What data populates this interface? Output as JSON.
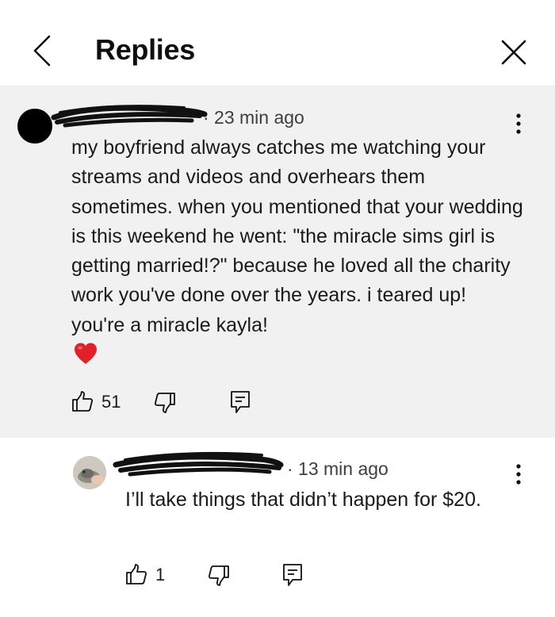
{
  "header": {
    "title": "Replies"
  },
  "parent_comment": {
    "time": "· 23 min ago",
    "text": "my boyfriend always catches me watching your streams and videos and overhears them sometimes. when you mentioned that your wedding is this weekend he went: \"the miracle sims girl is getting married!?\" because he loved all the charity work you've done over the years. i teared up! you're a miracle kayla!",
    "emoji": "heart",
    "likes": "51"
  },
  "reply": {
    "time": "· 13 min ago",
    "text": "I’ll take things that didn’t happen for $20.",
    "likes": "1"
  },
  "icons": {
    "back": "chevron-left-icon",
    "close": "close-icon",
    "more": "more-vertical-icon",
    "like": "thumbs-up-icon",
    "dislike": "thumbs-down-icon",
    "reply": "reply-icon",
    "heart": "heart-icon"
  },
  "colors": {
    "parent_bg": "#f1f1f1",
    "heart": "#e0202a"
  }
}
